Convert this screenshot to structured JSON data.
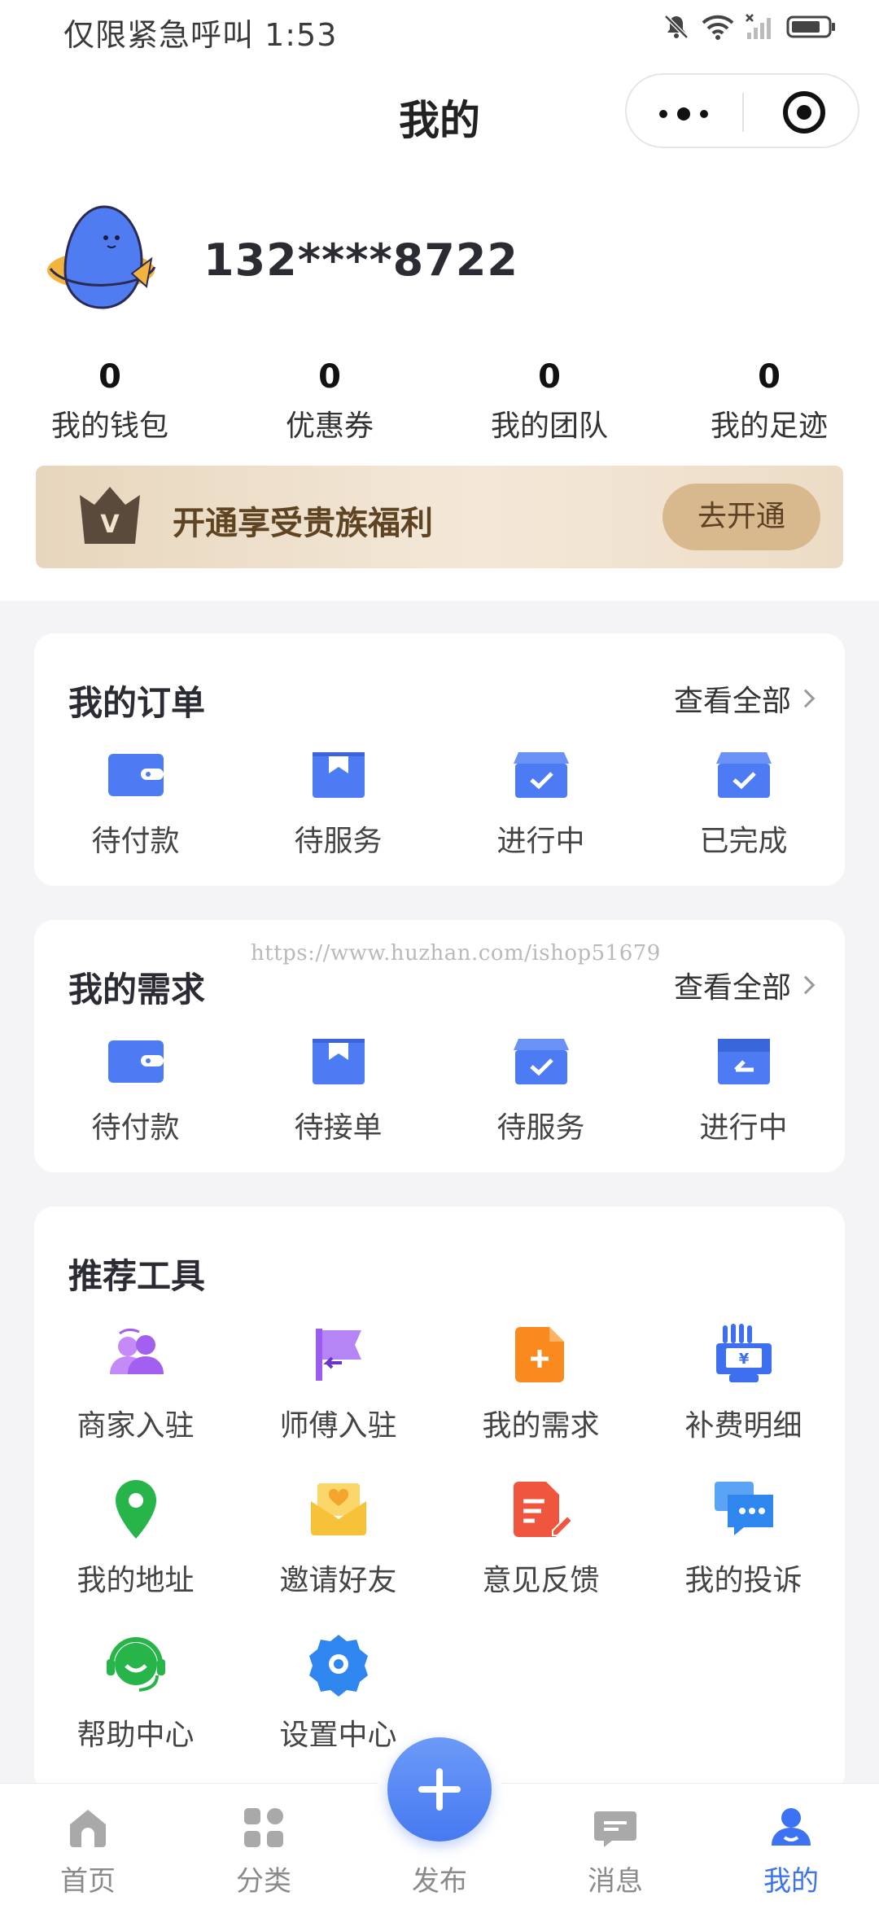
{
  "status_bar": {
    "left_text": "仅限紧急呼叫 1:53"
  },
  "page": {
    "title": "我的"
  },
  "profile": {
    "phone": "132****8722"
  },
  "stats": [
    {
      "value": "0",
      "label": "我的钱包"
    },
    {
      "value": "0",
      "label": "优惠券"
    },
    {
      "value": "0",
      "label": "我的团队"
    },
    {
      "value": "0",
      "label": "我的足迹"
    }
  ],
  "vip_banner": {
    "crown_letter": "V",
    "text": "开通享受贵族福利",
    "button": "去开通"
  },
  "orders": {
    "title": "我的订单",
    "more": "查看全部",
    "items": [
      {
        "label": "待付款",
        "icon": "wallet-icon"
      },
      {
        "label": "待服务",
        "icon": "bookmark-box-icon"
      },
      {
        "label": "进行中",
        "icon": "check-box-icon"
      },
      {
        "label": "已完成",
        "icon": "check-box-icon"
      }
    ]
  },
  "demands": {
    "title": "我的需求",
    "more": "查看全部",
    "items": [
      {
        "label": "待付款",
        "icon": "wallet-icon"
      },
      {
        "label": "待接单",
        "icon": "bookmark-box-icon"
      },
      {
        "label": "待服务",
        "icon": "check-box-icon"
      },
      {
        "label": "进行中",
        "icon": "progress-box-icon"
      }
    ]
  },
  "watermark": "https://www.huzhan.com/ishop51679",
  "tools": {
    "title": "推荐工具",
    "items": [
      {
        "label": "商家入驻",
        "icon": "merchant-users-icon",
        "color": "#a35ff0"
      },
      {
        "label": "师傅入驻",
        "icon": "flag-icon",
        "color": "#9b5cf0"
      },
      {
        "label": "我的需求",
        "icon": "document-add-icon",
        "color": "#fb8a1e"
      },
      {
        "label": "补费明细",
        "icon": "fee-hand-icon",
        "color": "#3d6fee"
      },
      {
        "label": "我的地址",
        "icon": "location-pin-icon",
        "color": "#27b54a"
      },
      {
        "label": "邀请好友",
        "icon": "invite-envelope-icon",
        "color": "#f6c23a"
      },
      {
        "label": "意见反馈",
        "icon": "feedback-edit-icon",
        "color": "#f0563e"
      },
      {
        "label": "我的投诉",
        "icon": "chat-bubbles-icon",
        "color": "#2f86ee"
      },
      {
        "label": "帮助中心",
        "icon": "headset-icon",
        "color": "#27b54a"
      },
      {
        "label": "设置中心",
        "icon": "settings-gear-icon",
        "color": "#2f86ee"
      }
    ]
  },
  "tabbar": {
    "items": [
      {
        "label": "首页",
        "icon": "home-icon"
      },
      {
        "label": "分类",
        "icon": "grid-icon"
      },
      {
        "label": "发布",
        "icon": "plus-icon"
      },
      {
        "label": "消息",
        "icon": "message-icon"
      },
      {
        "label": "我的",
        "icon": "user-icon",
        "active": true
      }
    ]
  },
  "colors": {
    "accent": "#3d73f2",
    "order_icon": "#4d7bf3",
    "vip_text": "#5e4422",
    "vip_button": "#d8b88d"
  }
}
